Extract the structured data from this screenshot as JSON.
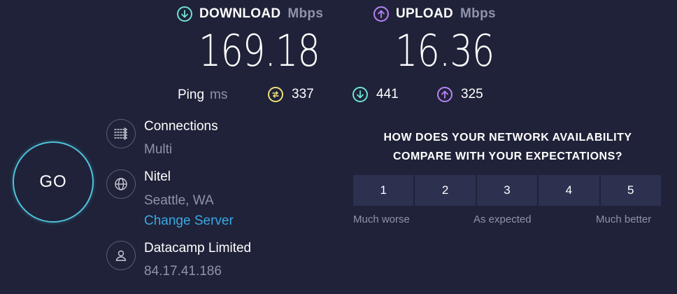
{
  "download": {
    "label": "DOWNLOAD",
    "unit": "Mbps",
    "value": "169.18",
    "icon": "arrow-down-circle-icon"
  },
  "upload": {
    "label": "UPLOAD",
    "unit": "Mbps",
    "value": "16.36",
    "icon": "arrow-up-circle-icon"
  },
  "ping": {
    "label": "Ping",
    "unit": "ms",
    "idle": "337",
    "download": "441",
    "upload": "325"
  },
  "go_button": {
    "label": "GO"
  },
  "connections": {
    "title": "Connections",
    "value": "Multi"
  },
  "server": {
    "name": "Nitel",
    "location": "Seattle, WA",
    "change_label": "Change Server"
  },
  "provider": {
    "name": "Datacamp Limited",
    "ip": "84.17.41.186"
  },
  "survey": {
    "question": "HOW DOES YOUR NETWORK AVAILABILITY COMPARE WITH YOUR EXPECTATIONS?",
    "options": [
      "1",
      "2",
      "3",
      "4",
      "5"
    ],
    "labels": {
      "low": "Much worse",
      "mid": "As expected",
      "high": "Much better"
    }
  },
  "colors": {
    "background": "#1f2238",
    "download_accent": "#6fe1d6",
    "upload_accent": "#b983f8",
    "ping_idle_accent": "#f1e07a",
    "go_ring": "#4fc3dc",
    "link": "#3ba8e6"
  }
}
